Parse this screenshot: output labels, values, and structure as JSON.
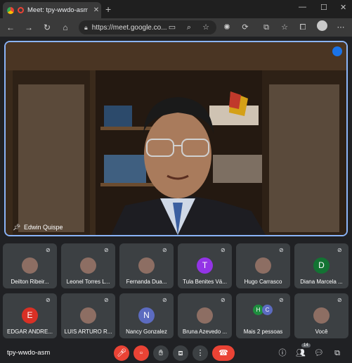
{
  "browser": {
    "tab_title": "Meet: tpy-wwdo-asm",
    "url": "https://meet.google.co..."
  },
  "main_speaker": {
    "name": "Edwin Quispe"
  },
  "tiles": [
    {
      "name": "Deilton Ribeir...",
      "initial": "",
      "color": "#5f6368",
      "photo": true
    },
    {
      "name": "Leonel Torres L...",
      "initial": "",
      "color": "#3c4043",
      "photo": true
    },
    {
      "name": "Fernanda Dua...",
      "initial": "",
      "color": "#3c4043",
      "photo": true
    },
    {
      "name": "Tula Benites Vá...",
      "initial": "T",
      "color": "#9334e6"
    },
    {
      "name": "Hugo Carrasco",
      "initial": "",
      "color": "#3c4043",
      "photo": true
    },
    {
      "name": "Diana Marcela ...",
      "initial": "D",
      "color": "#137333"
    },
    {
      "name": "EDGAR ANDRE...",
      "initial": "E",
      "color": "#d93025"
    },
    {
      "name": "LUIS ARTURO R...",
      "initial": "",
      "color": "#3c4043",
      "photo": true
    },
    {
      "name": "Nancy Gonzalez",
      "initial": "N",
      "color": "#5c6bc0"
    },
    {
      "name": "Bruna Azevedo ...",
      "initial": "",
      "color": "#3c4043",
      "photo": true
    },
    {
      "name": "Mais 2 pessoas",
      "initial": "",
      "color": "#3c4043",
      "group": [
        "H",
        "C"
      ]
    },
    {
      "name": "Você",
      "initial": "",
      "color": "#3c4043",
      "photo": true
    }
  ],
  "bottom": {
    "meeting_code": "tpy-wwdo-asm",
    "participant_count": "14"
  }
}
